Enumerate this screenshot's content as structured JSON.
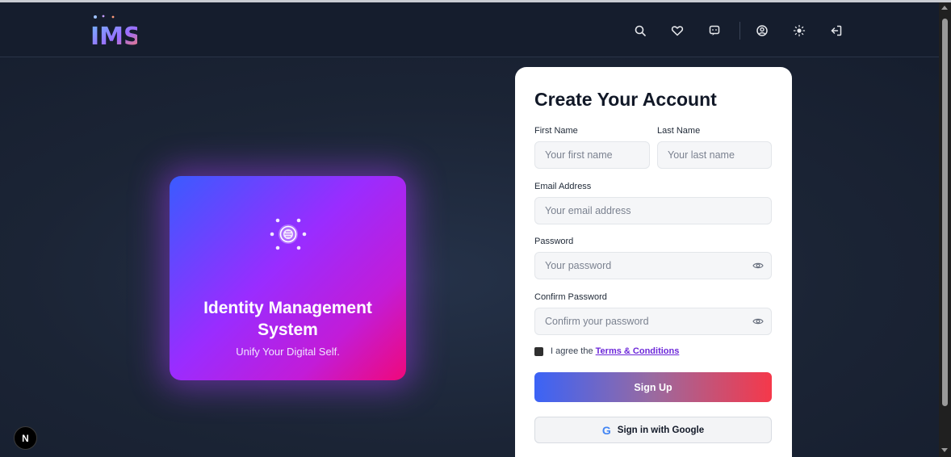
{
  "header": {
    "logo_text": "IMS",
    "icons": [
      "search-icon",
      "heart-icon",
      "chat-icon",
      "user-circle-icon",
      "sun-icon",
      "logout-icon"
    ]
  },
  "hero": {
    "title_line1": "Identity Management",
    "title_line2": "System",
    "subtitle": "Unify Your Digital Self."
  },
  "form": {
    "title": "Create Your Account",
    "first_name_label": "First Name",
    "first_name_placeholder": "Your first name",
    "last_name_label": "Last Name",
    "last_name_placeholder": "Your last name",
    "email_label": "Email Address",
    "email_placeholder": "Your email address",
    "password_label": "Password",
    "password_placeholder": "Your password",
    "confirm_label": "Confirm Password",
    "confirm_placeholder": "Confirm your password",
    "agree_prefix": "I agree the ",
    "terms_link": "Terms & Conditions",
    "signup_button": "Sign Up",
    "google_letter": "G",
    "google_button": "Sign in with Google"
  },
  "badge": {
    "letter": "N"
  },
  "colors": {
    "accent_start": "#3b63f6",
    "accent_end": "#f5384a",
    "hero_start": "#3a5bff",
    "hero_end": "#f0087a",
    "link": "#6d28d9"
  }
}
